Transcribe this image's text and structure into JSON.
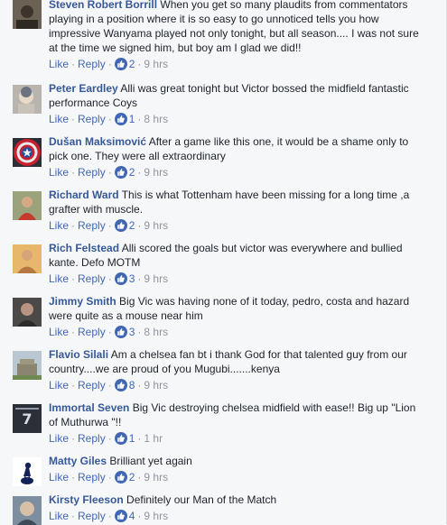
{
  "actions": {
    "like_label": "Like",
    "reply_label": "Reply",
    "separator": "·"
  },
  "colors": {
    "author_link": "#365899",
    "action_link": "#4267b2",
    "meta_grey": "#90949c",
    "like_badge": "#4267b2",
    "background": "#f6f7f9"
  },
  "comments": [
    {
      "author": "Steven Robert Borrill",
      "text": "When you get so many plaudits from commentators playing in a position where it is so easy to go unnoticed tells you how impressive Wanyama played not only tonight, but all season.... I was not sure at the time we signed him, but boy am I glad we did!!",
      "likes": "2",
      "time": "9 hrs",
      "avatar_icon": "user-photo-icon"
    },
    {
      "author": "Peter Eardley",
      "text": "Alli was great tonight but Victor bossed the midfield fantastic performance Coys",
      "likes": "1",
      "time": "8 hrs",
      "avatar_icon": "user-photo-icon"
    },
    {
      "author": "Dušan Maksimović",
      "text": "After a game like this one, it would be a shame only to pick one. They were all extraordinary",
      "likes": "2",
      "time": "9 hrs",
      "avatar_icon": "captain-america-shield-icon"
    },
    {
      "author": "Richard Ward",
      "text": "This is what Tottenham have been missing for a long time ,a grafter with muscle.",
      "likes": "2",
      "time": "9 hrs",
      "avatar_icon": "user-photo-icon"
    },
    {
      "author": "Rich Felstead",
      "text": "Alli scored the goals but victor was everywhere and bullied kante. Defo MOTM",
      "likes": "3",
      "time": "9 hrs",
      "avatar_icon": "user-photo-icon"
    },
    {
      "author": "Jimmy Smith",
      "text": "Big Vic was having none of it today, pedro, costa and hazard were quite as a mouse near him",
      "likes": "3",
      "time": "8 hrs",
      "avatar_icon": "user-photo-icon"
    },
    {
      "author": "Flavio Silali",
      "text": "Am a chelsea fan bt i thank God for that talented guy from our country....we are proud of you Mugubi.......kenya",
      "likes": "8",
      "time": "9 hrs",
      "avatar_icon": "user-photo-icon"
    },
    {
      "author": "Immortal Seven",
      "text": "Big Vic destroying chelsea midfield with ease!! Big up \"Lion of Muthurwa \"!!",
      "likes": "1",
      "time": "1 hr",
      "avatar_icon": "user-photo-icon"
    },
    {
      "author": "Matty Giles",
      "text": "Brilliant yet again",
      "likes": "2",
      "time": "9 hrs",
      "avatar_icon": "tottenham-crest-icon"
    },
    {
      "author": "Kirsty Fleeson",
      "text": "Definitely our Man of the Match",
      "likes": "4",
      "time": "9 hrs",
      "avatar_icon": "user-photo-icon"
    }
  ]
}
